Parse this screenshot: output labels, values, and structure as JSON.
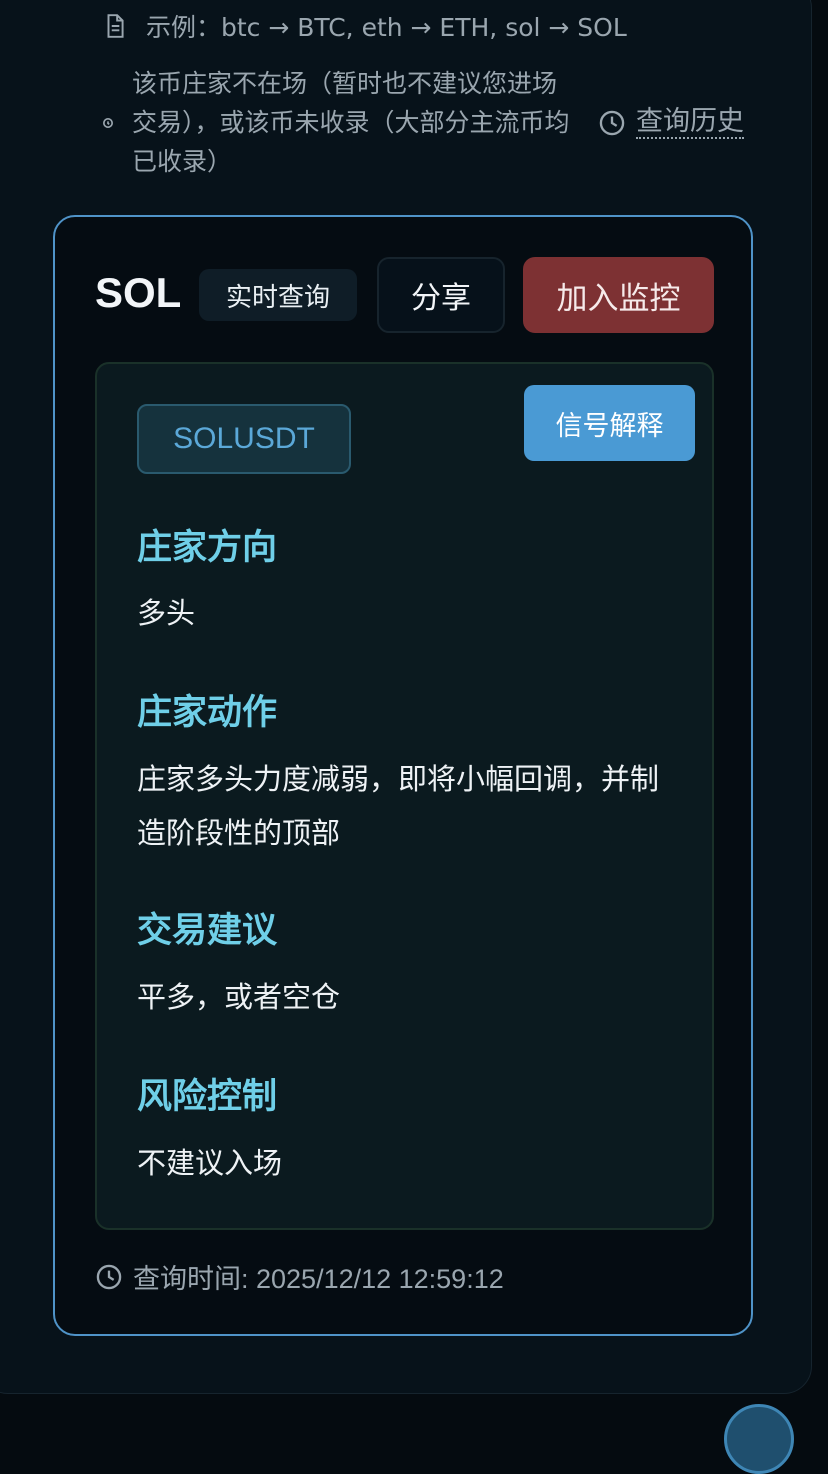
{
  "hint": {
    "example_text": "示例：btc → BTC, eth → ETH, sol → SOL"
  },
  "notice": {
    "text": "该币庄家不在场（暂时也不建议您进场交易），或该币未收录（大部分主流币均已收录）",
    "history_link": "查询历史"
  },
  "result": {
    "symbol": "SOL",
    "live_label": "实时查询",
    "share_label": "分享",
    "monitor_label": "加入监控",
    "pair": "SOLUSDT",
    "explain_label": "信号解释",
    "sections": [
      {
        "heading": "庄家方向",
        "body": "多头"
      },
      {
        "heading": "庄家动作",
        "body": "庄家多头力度减弱，即将小幅回调，并制造阶段性的顶部"
      },
      {
        "heading": "交易建议",
        "body": "平多，或者空仓"
      },
      {
        "heading": "风险控制",
        "body": "不建议入场"
      }
    ],
    "query_time": "查询时间: 2025/12/12 12:59:12"
  },
  "colors": {
    "accent_border": "#4f93c8",
    "heading": "#6fcfe8",
    "monitor": "#7d3133",
    "explain": "#4a9ad4"
  }
}
